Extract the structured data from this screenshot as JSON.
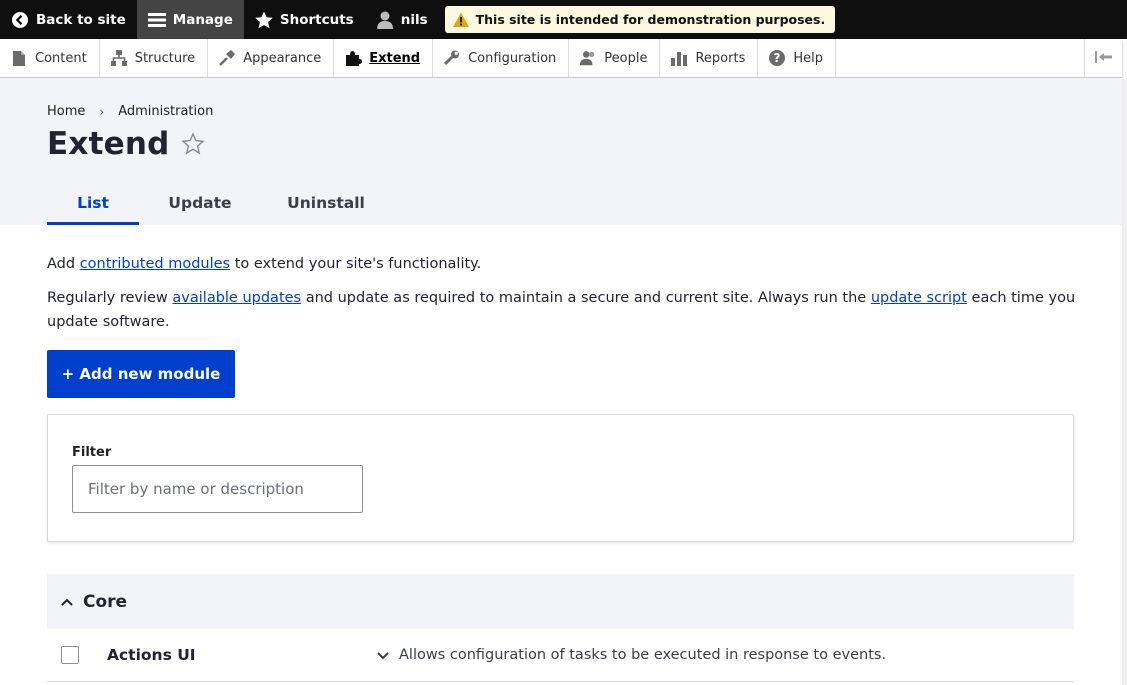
{
  "toolbar": {
    "back_label": "Back to site",
    "manage_label": "Manage",
    "shortcuts_label": "Shortcuts",
    "user_label": "nils",
    "demo_notice": "This site is intended for demonstration purposes."
  },
  "tray": {
    "items": [
      {
        "label": "Content",
        "icon": "file-icon"
      },
      {
        "label": "Structure",
        "icon": "structure-icon"
      },
      {
        "label": "Appearance",
        "icon": "paintbrush-icon"
      },
      {
        "label": "Extend",
        "icon": "puzzle-icon"
      },
      {
        "label": "Configuration",
        "icon": "wrench-icon"
      },
      {
        "label": "People",
        "icon": "people-icon"
      },
      {
        "label": "Reports",
        "icon": "bar-chart-icon"
      },
      {
        "label": "Help",
        "icon": "help-icon"
      }
    ]
  },
  "breadcrumb": {
    "home": "Home",
    "separator": "›",
    "admin": "Administration"
  },
  "page": {
    "title": "Extend"
  },
  "tabs": {
    "list": "List",
    "update": "Update",
    "uninstall": "Uninstall"
  },
  "intro": {
    "p1_before": "Add ",
    "p1_link": "contributed modules",
    "p1_after": " to extend your site's functionality.",
    "p2_before": "Regularly review ",
    "p2_link1": "available updates",
    "p2_mid": " and update as required to maintain a secure and current site. Always run the ",
    "p2_link2": "update script",
    "p2_after": " each time you update software."
  },
  "add_button": "+ Add new module",
  "filter": {
    "label": "Filter",
    "placeholder": "Filter by name or description",
    "value": ""
  },
  "core": {
    "title": "Core"
  },
  "modules": [
    {
      "name": "Actions UI",
      "description": "Allows configuration of tasks to be executed in response to events."
    }
  ],
  "colors": {
    "accent": "#003ecc",
    "toolbar_bg": "#0f0f0f",
    "header_bg": "#f3f4f9",
    "demo_banner_bg": "#fdf8e0"
  }
}
